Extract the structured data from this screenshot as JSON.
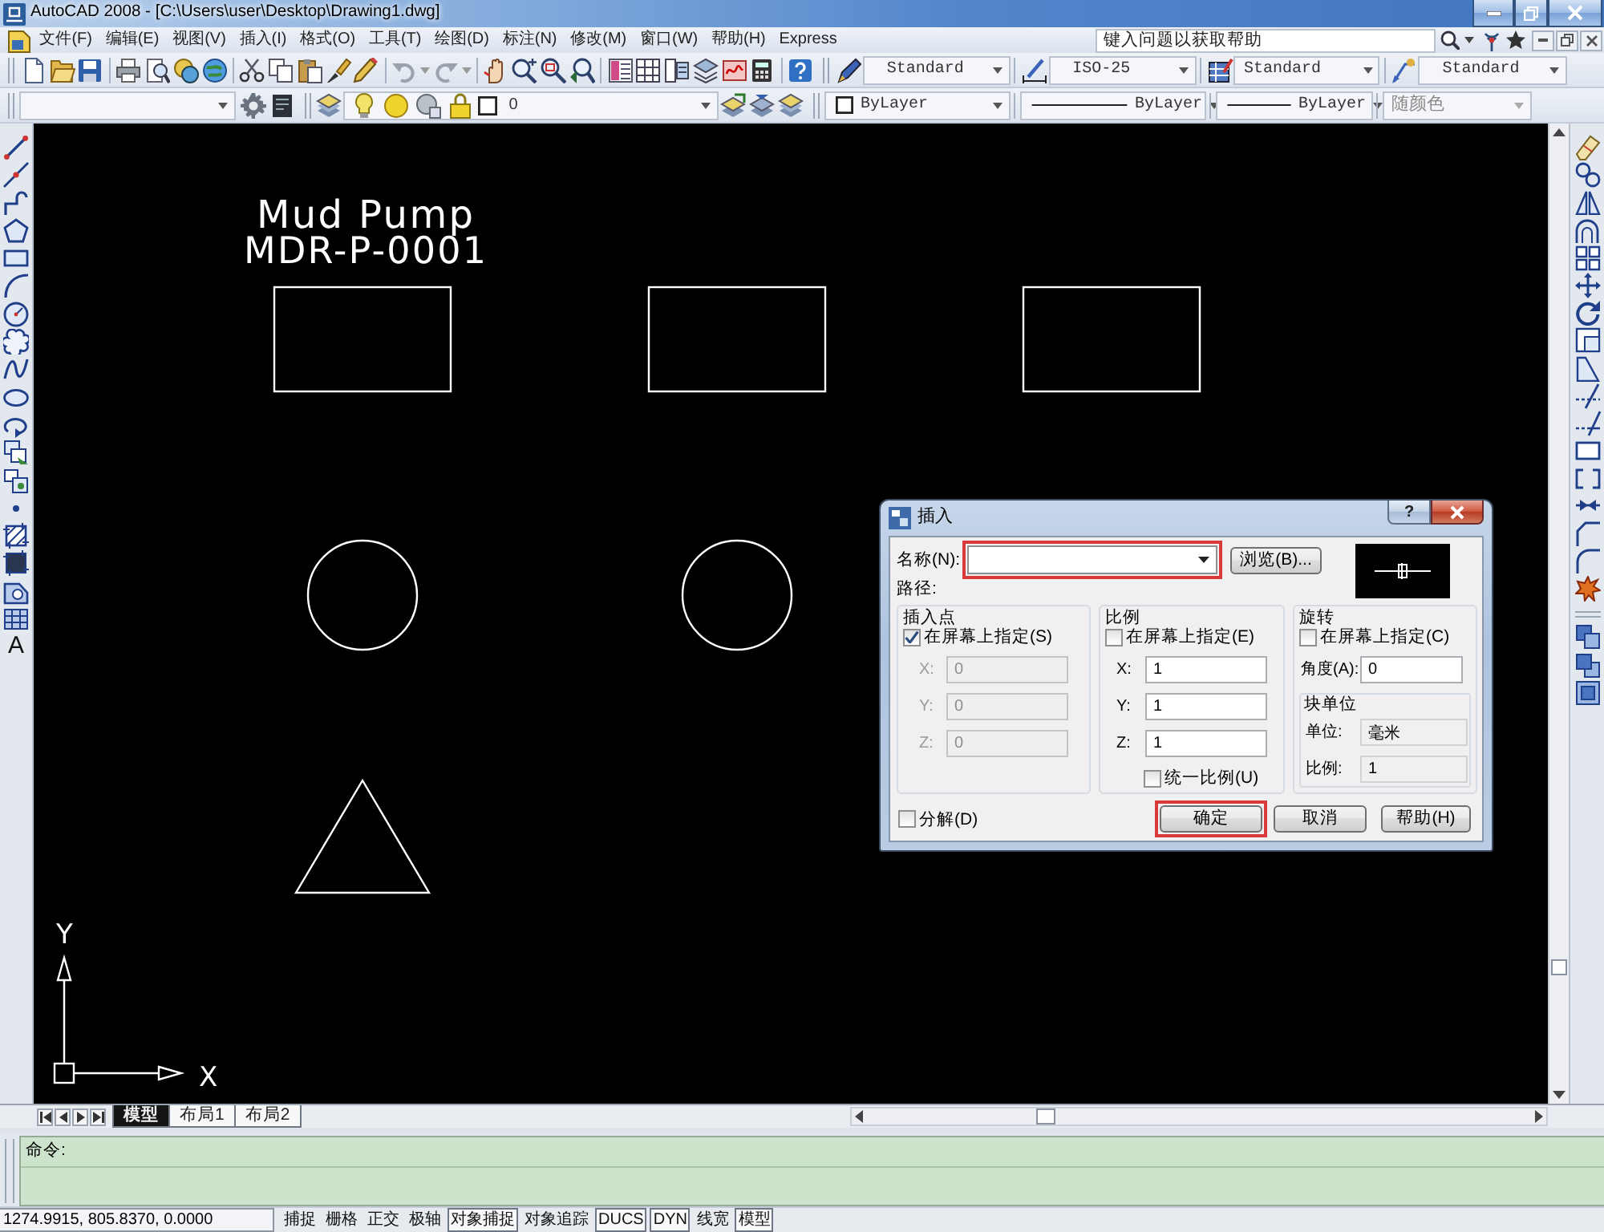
{
  "window": {
    "title": "AutoCAD 2008 - [C:\\Users\\user\\Desktop\\Drawing1.dwg]"
  },
  "menu_bar": {
    "items": [
      "文件(F)",
      "编辑(E)",
      "视图(V)",
      "插入(I)",
      "格式(O)",
      "工具(T)",
      "绘图(D)",
      "标注(N)",
      "修改(M)",
      "窗口(W)",
      "帮助(H)",
      "Express"
    ],
    "help_search": {
      "placeholder": "键入问题以获取帮助"
    }
  },
  "styles_toolbar": {
    "combos": [
      {
        "kind": "text_style",
        "value": "Standard"
      },
      {
        "kind": "dimension_style",
        "value": "ISO-25"
      },
      {
        "kind": "table_style",
        "value": "Standard"
      },
      {
        "kind": "multileader_style",
        "value": "Standard"
      }
    ]
  },
  "layers_toolbar": {
    "layer": "0"
  },
  "properties_toolbar": {
    "combos": [
      {
        "kind": "color",
        "value": "ByLayer",
        "disabled": false
      },
      {
        "kind": "linetype",
        "value": "ByLayer",
        "disabled": false
      },
      {
        "kind": "lineweight",
        "value": "ByLayer",
        "disabled": false
      },
      {
        "kind": "plot_style",
        "value": "随颜色",
        "disabled": true
      }
    ]
  },
  "draw_toolbar": {
    "text_tool_glyph": "A"
  },
  "drawing": {
    "title": "Mud Pump",
    "tag": "MDR-P-0001",
    "shape_rows": [
      {
        "shapes": [
          {
            "kind": "rectangle"
          },
          {
            "kind": "rectangle"
          },
          {
            "kind": "rectangle"
          }
        ]
      },
      {
        "shapes": [
          {
            "kind": "circle"
          },
          {
            "kind": "circle"
          }
        ]
      },
      {
        "shapes": [
          {
            "kind": "triangle"
          }
        ]
      }
    ],
    "ucs": {
      "y_label": "Y",
      "x_label": "X"
    }
  },
  "insert_dialog": {
    "title": "插入",
    "help_glyph": "?",
    "name": {
      "label": "名称(N):",
      "highlighted": true
    },
    "browse_button": "浏览(B)...",
    "path_label": "路径:",
    "insertion_point": {
      "title": "插入点",
      "specify_on_screen": {
        "label": "在屏幕上指定(S)",
        "checked": true
      },
      "fields": [
        {
          "label": "X:",
          "value": "0"
        },
        {
          "label": "Y:",
          "value": "0"
        },
        {
          "label": "Z:",
          "value": "0"
        }
      ]
    },
    "scale": {
      "title": "比例",
      "specify_on_screen": {
        "label": "在屏幕上指定(E)",
        "checked": false
      },
      "fields": [
        {
          "label": "X:",
          "value": "1"
        },
        {
          "label": "Y:",
          "value": "1"
        },
        {
          "label": "Z:",
          "value": "1"
        }
      ],
      "uniform_scale": {
        "label": "统一比例(U)",
        "checked": false
      }
    },
    "rotation": {
      "title": "旋转",
      "specify_on_screen": {
        "label": "在屏幕上指定(C)",
        "checked": false
      },
      "angle": {
        "label": "角度(A):",
        "value": "0"
      }
    },
    "block_unit": {
      "title": "块单位",
      "unit": {
        "label": "单位:",
        "value": "毫米"
      },
      "factor": {
        "label": "比例:",
        "value": "1"
      }
    },
    "explode": {
      "label": "分解(D)",
      "checked": false
    },
    "buttons": [
      {
        "label": "确定",
        "highlighted": true
      },
      {
        "label": "取消",
        "highlighted": false
      },
      {
        "label": "帮助(H)",
        "highlighted": false
      }
    ]
  },
  "layout_tabs": [
    {
      "label": "模型",
      "selected": true
    },
    {
      "label": "布局1",
      "selected": false
    },
    {
      "label": "布局2",
      "selected": false
    }
  ],
  "command_line": {
    "prompt": "命令:"
  },
  "status_bar": {
    "coordinates": "1274.9915, 805.8370, 0.0000",
    "toggles": [
      {
        "label": "捕捉",
        "on": false
      },
      {
        "label": "栅格",
        "on": false
      },
      {
        "label": "正交",
        "on": false
      },
      {
        "label": "极轴",
        "on": false
      },
      {
        "label": "对象捕捉",
        "on": true
      },
      {
        "label": "对象追踪",
        "on": false
      },
      {
        "label": "DUCS",
        "on": true
      },
      {
        "label": "DYN",
        "on": true
      },
      {
        "label": "线宽",
        "on": false
      },
      {
        "label": "模型",
        "on": true
      }
    ]
  }
}
